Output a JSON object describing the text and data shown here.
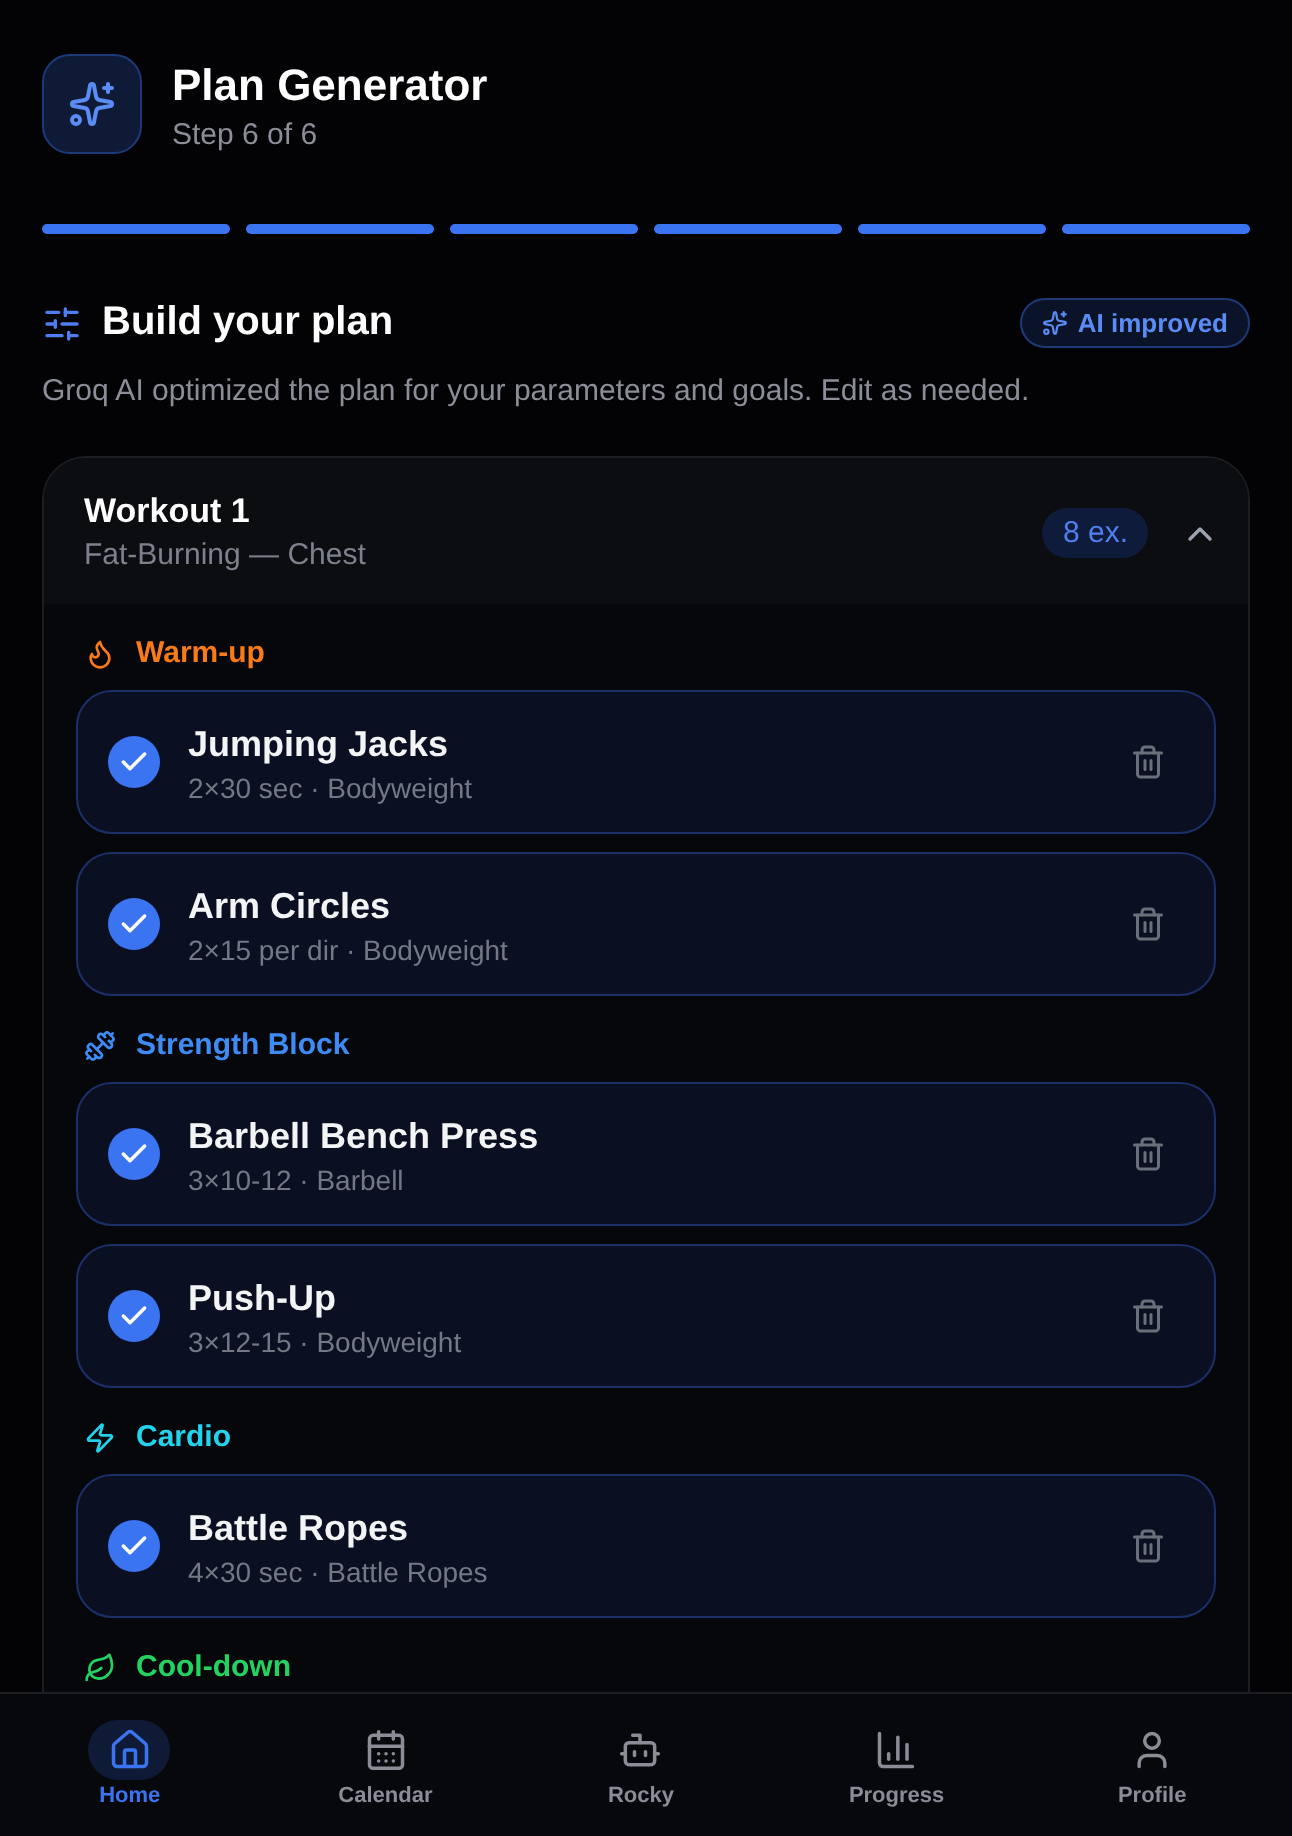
{
  "header": {
    "title": "Plan Generator",
    "subtitle": "Step 6 of 6"
  },
  "progress_steps": [
    {
      "completed": true
    },
    {
      "completed": true
    },
    {
      "completed": true
    },
    {
      "completed": true
    },
    {
      "completed": true
    },
    {
      "completed": true
    }
  ],
  "section": {
    "title": "Build your plan",
    "badge": "AI improved",
    "description": "Groq AI optimized the plan for your parameters and goals. Edit as needed."
  },
  "workout": {
    "title": "Workout 1",
    "subtitle": "Fat-Burning — Chest",
    "count": "8 ex.",
    "expanded": true,
    "blocks": [
      {
        "kind": "warmup",
        "title": "Warm-up",
        "color": "#f97a16",
        "exercises": [
          {
            "name": "Jumping Jacks",
            "detail": "2×30 sec · Bodyweight",
            "checked": true
          },
          {
            "name": "Arm Circles",
            "detail": "2×15 per dir · Bodyweight",
            "checked": true
          }
        ]
      },
      {
        "kind": "strength",
        "title": "Strength Block",
        "color": "#3d8cf5",
        "exercises": [
          {
            "name": "Barbell Bench Press",
            "detail": "3×10-12 · Barbell",
            "checked": true
          },
          {
            "name": "Push-Up",
            "detail": "3×12-15 · Bodyweight",
            "checked": true
          }
        ]
      },
      {
        "kind": "cardio",
        "title": "Cardio",
        "color": "#22d3ee",
        "exercises": [
          {
            "name": "Battle Ropes",
            "detail": "4×30 sec · Battle Ropes",
            "checked": true
          }
        ]
      },
      {
        "kind": "cooldown",
        "title": "Cool-down",
        "color": "#22d361"
      }
    ]
  },
  "nav": {
    "items": [
      {
        "label": "Home",
        "selected": true
      },
      {
        "label": "Calendar",
        "selected": false
      },
      {
        "label": "Rocky",
        "selected": false
      },
      {
        "label": "Progress",
        "selected": false
      },
      {
        "label": "Profile",
        "selected": false
      }
    ]
  }
}
